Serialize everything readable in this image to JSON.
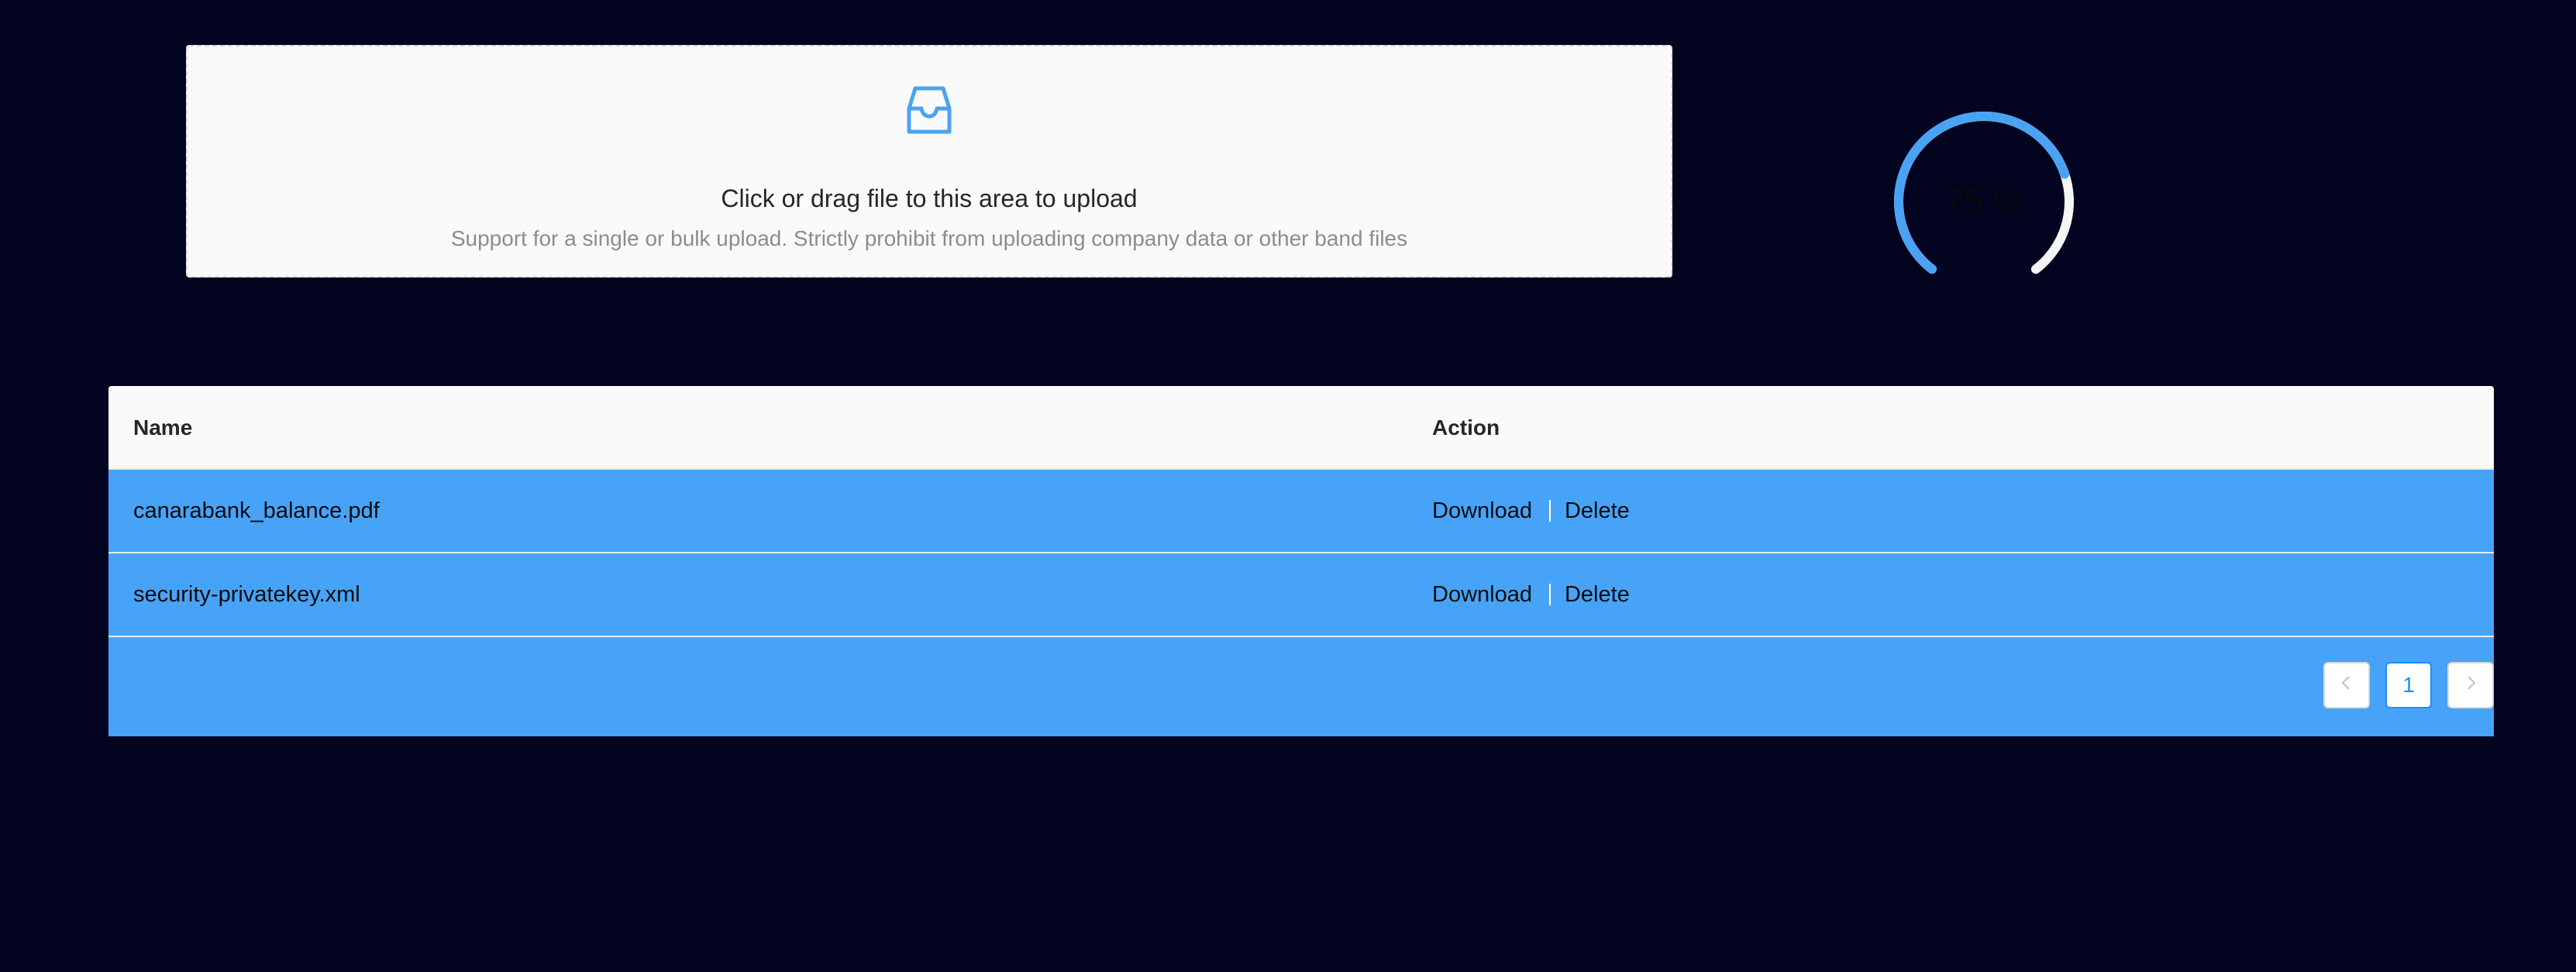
{
  "upload": {
    "icon": "inbox-icon",
    "text": "Click or drag file to this area to upload",
    "hint": "Support for a single or bulk upload. Strictly prohibit from uploading company data or other band files"
  },
  "progress": {
    "type": "dashboard",
    "percent": 75,
    "label": "75 %",
    "stroke_color": "#4aa3f2",
    "trail_color": "#f5f5f5"
  },
  "table": {
    "columns": [
      "Name",
      "Action"
    ],
    "rows": [
      {
        "name": "canarabank_balance.pdf",
        "actions": [
          "Download",
          "Delete"
        ]
      },
      {
        "name": "security-privatekey.xml",
        "actions": [
          "Download",
          "Delete"
        ]
      }
    ],
    "row_color": "#47a3f7"
  },
  "pagination": {
    "prev_icon": "chevron-left-icon",
    "next_icon": "chevron-right-icon",
    "current_page": "1"
  },
  "colors": {
    "background": "#020420",
    "accent": "#1890ff"
  }
}
